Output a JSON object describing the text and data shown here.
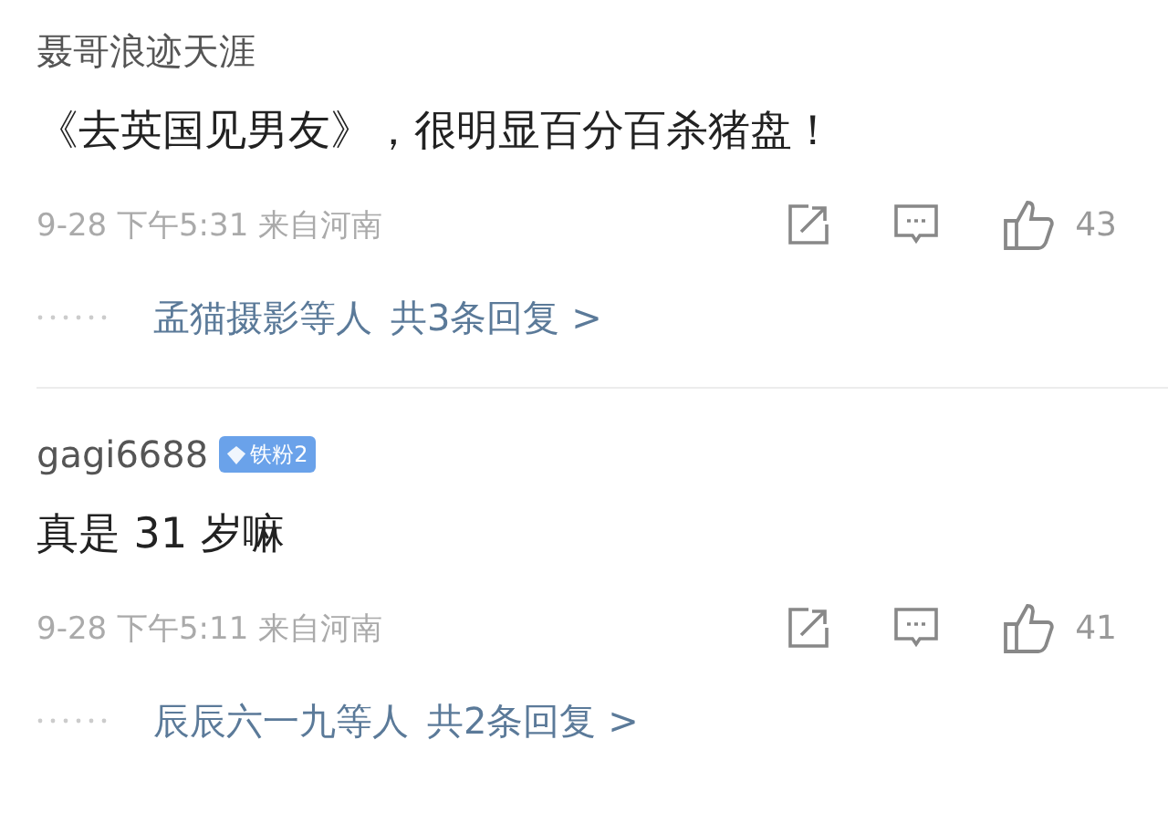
{
  "comments": [
    {
      "username": "聂哥浪迹天涯",
      "text": "《去英国见男友》，很明显百分百杀猪盘！",
      "time": "9-28 下午5:31 来自河南",
      "likes": "43",
      "repliers": "孟猫摄影等人",
      "reply_link": "共3条回复 >"
    },
    {
      "username": "gagi6688",
      "badge": "铁粉2",
      "text": "真是 31 岁嘛",
      "time": "9-28 下午5:11 来自河南",
      "likes": "41",
      "repliers": "辰辰六一九等人",
      "reply_link": "共2条回复 >"
    }
  ]
}
